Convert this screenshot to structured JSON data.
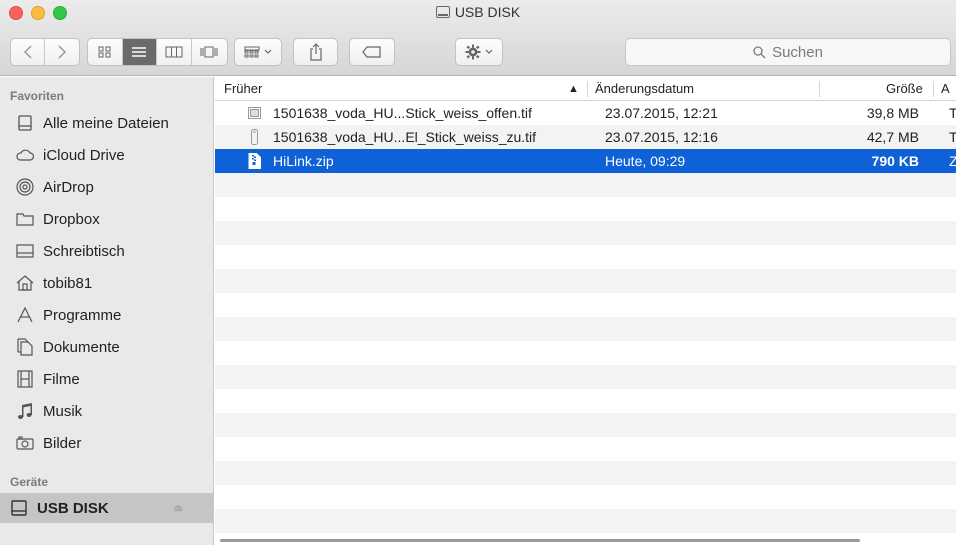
{
  "window": {
    "title": "USB DISK"
  },
  "toolbar": {
    "back_icon": "chevron-left",
    "forward_icon": "chevron-right",
    "view_modes": [
      "icon-view",
      "list-view",
      "column-view",
      "coverflow-view"
    ],
    "group_icon": "grid-group",
    "share_icon": "share",
    "tag_icon": "tag",
    "action_icon": "gear",
    "search_placeholder": "Suchen"
  },
  "sidebar": {
    "favorites_label": "Favoriten",
    "favorites": [
      {
        "label": "Alle meine Dateien",
        "icon": "all-files-icon"
      },
      {
        "label": "iCloud Drive",
        "icon": "cloud-icon"
      },
      {
        "label": "AirDrop",
        "icon": "airdrop-icon"
      },
      {
        "label": "Dropbox",
        "icon": "folder-icon"
      },
      {
        "label": "Schreibtisch",
        "icon": "desktop-icon"
      },
      {
        "label": "tobib81",
        "icon": "home-icon"
      },
      {
        "label": "Programme",
        "icon": "applications-icon"
      },
      {
        "label": "Dokumente",
        "icon": "documents-icon"
      },
      {
        "label": "Filme",
        "icon": "movies-icon"
      },
      {
        "label": "Musik",
        "icon": "music-icon"
      },
      {
        "label": "Bilder",
        "icon": "camera-icon"
      }
    ],
    "devices_label": "Geräte",
    "devices": [
      {
        "label": "USB DISK",
        "icon": "disk-icon"
      }
    ]
  },
  "list": {
    "columns": {
      "name": "Früher",
      "date": "Änderungsdatum",
      "size": "Größe",
      "kind": "A"
    },
    "rows": [
      {
        "name": "1501638_voda_HU...Stick_weiss_offen.tif",
        "date": "23.07.2015, 12:21",
        "size": "39,8 MB",
        "kind": "T"
      },
      {
        "name": "1501638_voda_HU...El_Stick_weiss_zu.tif",
        "date": "23.07.2015, 12:16",
        "size": "42,7 MB",
        "kind": "T"
      },
      {
        "name": "HiLink.zip",
        "date": "Heute, 09:29",
        "size": "790 KB",
        "kind": "Z"
      }
    ],
    "selected_row": 2
  },
  "colors": {
    "selection": "#0f61d8",
    "sidebar_bg": "#e9e9e9"
  }
}
